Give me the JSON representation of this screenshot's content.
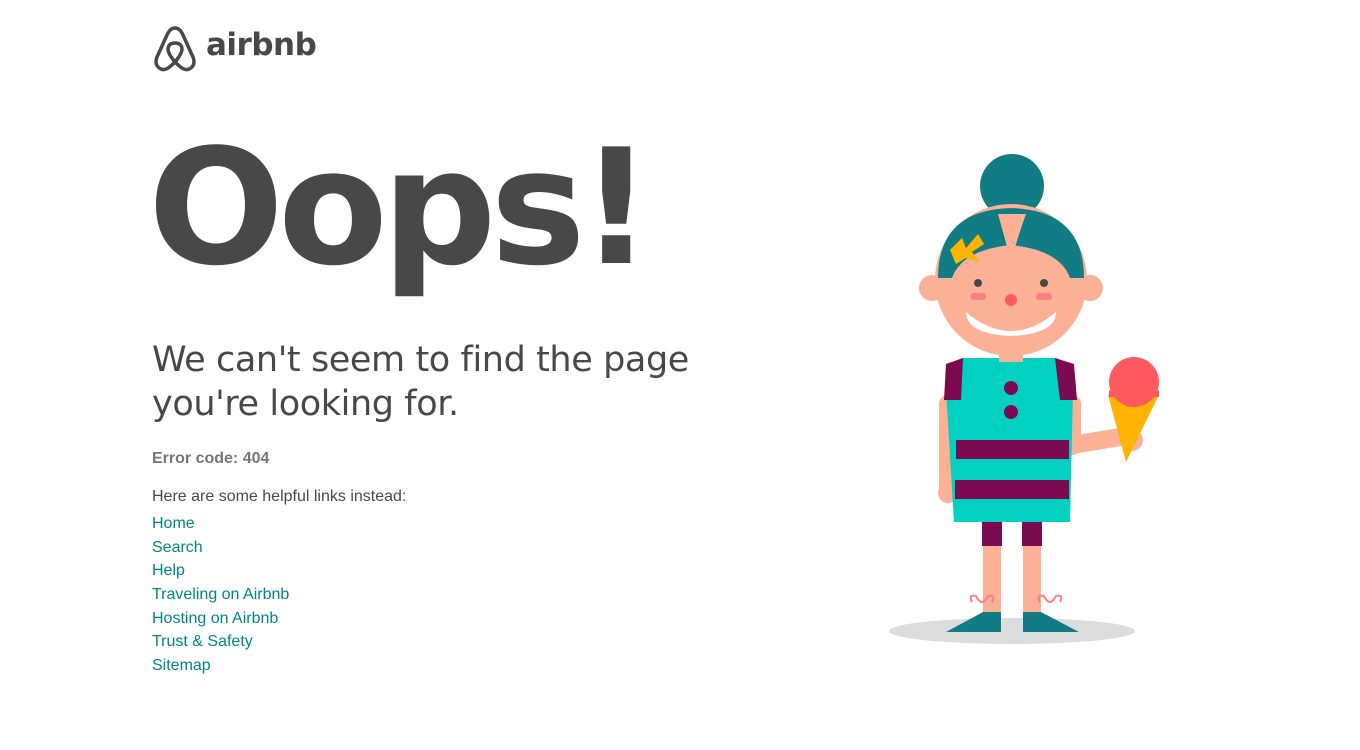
{
  "brand": {
    "name": "airbnb",
    "text_color": "#484848",
    "link_color": "#008489"
  },
  "error_page": {
    "headline": "Oops!",
    "message": "We can't seem to find the page you're looking for.",
    "error_code": "Error code: 404",
    "links_intro": "Here are some helpful links instead:",
    "links": [
      {
        "label": "Home"
      },
      {
        "label": "Search"
      },
      {
        "label": "Help"
      },
      {
        "label": "Traveling on Airbnb"
      },
      {
        "label": "Hosting on Airbnb"
      },
      {
        "label": "Trust & Safety"
      },
      {
        "label": "Sitemap"
      }
    ]
  },
  "illustration": {
    "subject": "girl-with-ice-cream",
    "colors": {
      "hair": "#127c85",
      "skin": "#fcb096",
      "dress": "#00d1c1",
      "stripes": "#7b0a50",
      "bow": "#ffb400",
      "ice_cream": "#ff5a5f",
      "cone": "#ffb400",
      "shadow": "#dcdcdc"
    }
  }
}
